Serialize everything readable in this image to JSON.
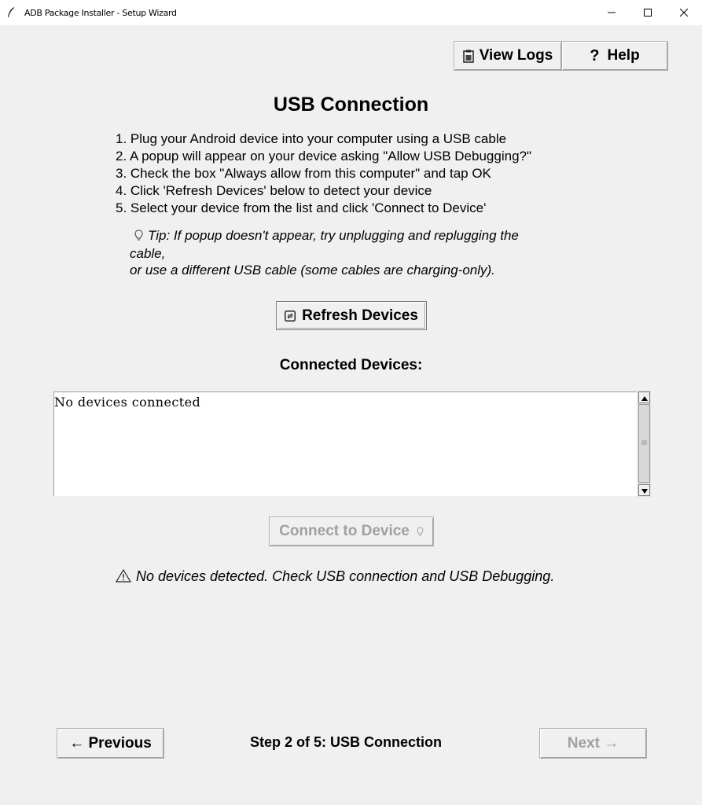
{
  "window": {
    "title": "ADB Package Installer - Setup Wizard",
    "controls": [
      "minimize-icon",
      "maximize-icon",
      "close-icon"
    ]
  },
  "toolbar": {
    "view_logs_label": "View Logs",
    "view_logs_icon": "clipboard-icon",
    "help_icon_glyph": "?",
    "help_label": "Help"
  },
  "main": {
    "title": "USB Connection",
    "steps": [
      "1. Plug your Android device into your computer using a USB cable",
      "2. A popup will appear on your device asking \"Allow USB Debugging?\"",
      "3. Check the box \"Always allow from this computer\" and tap OK",
      "4. Click 'Refresh Devices' below to detect your device",
      "5. Select your device from the list and click 'Connect to Device'"
    ],
    "tip_lines": [
      "Tip: If popup doesn't appear, try unplugging and replugging the",
      "cable,",
      "or use a different USB cable (some cables are charging-only)."
    ],
    "tip_icon": "lightbulb-icon",
    "refresh_label": "Refresh Devices",
    "refresh_icon": "refresh-icon",
    "devices_heading": "Connected Devices:",
    "devices_list": [
      "No devices connected"
    ],
    "connect_label": "Connect to Device",
    "connect_enabled": false,
    "status_text": "No devices detected. Check USB connection and USB Debugging.",
    "status_icon": "warning-icon"
  },
  "footer": {
    "previous_label": "← Previous",
    "step_text": "Step 2 of 5: USB Connection",
    "next_label": "Next →",
    "next_enabled": false
  },
  "colors": {
    "background": "#f0f0f0",
    "disabled_text": "#a0a0a0",
    "list_background": "#ffffff"
  }
}
